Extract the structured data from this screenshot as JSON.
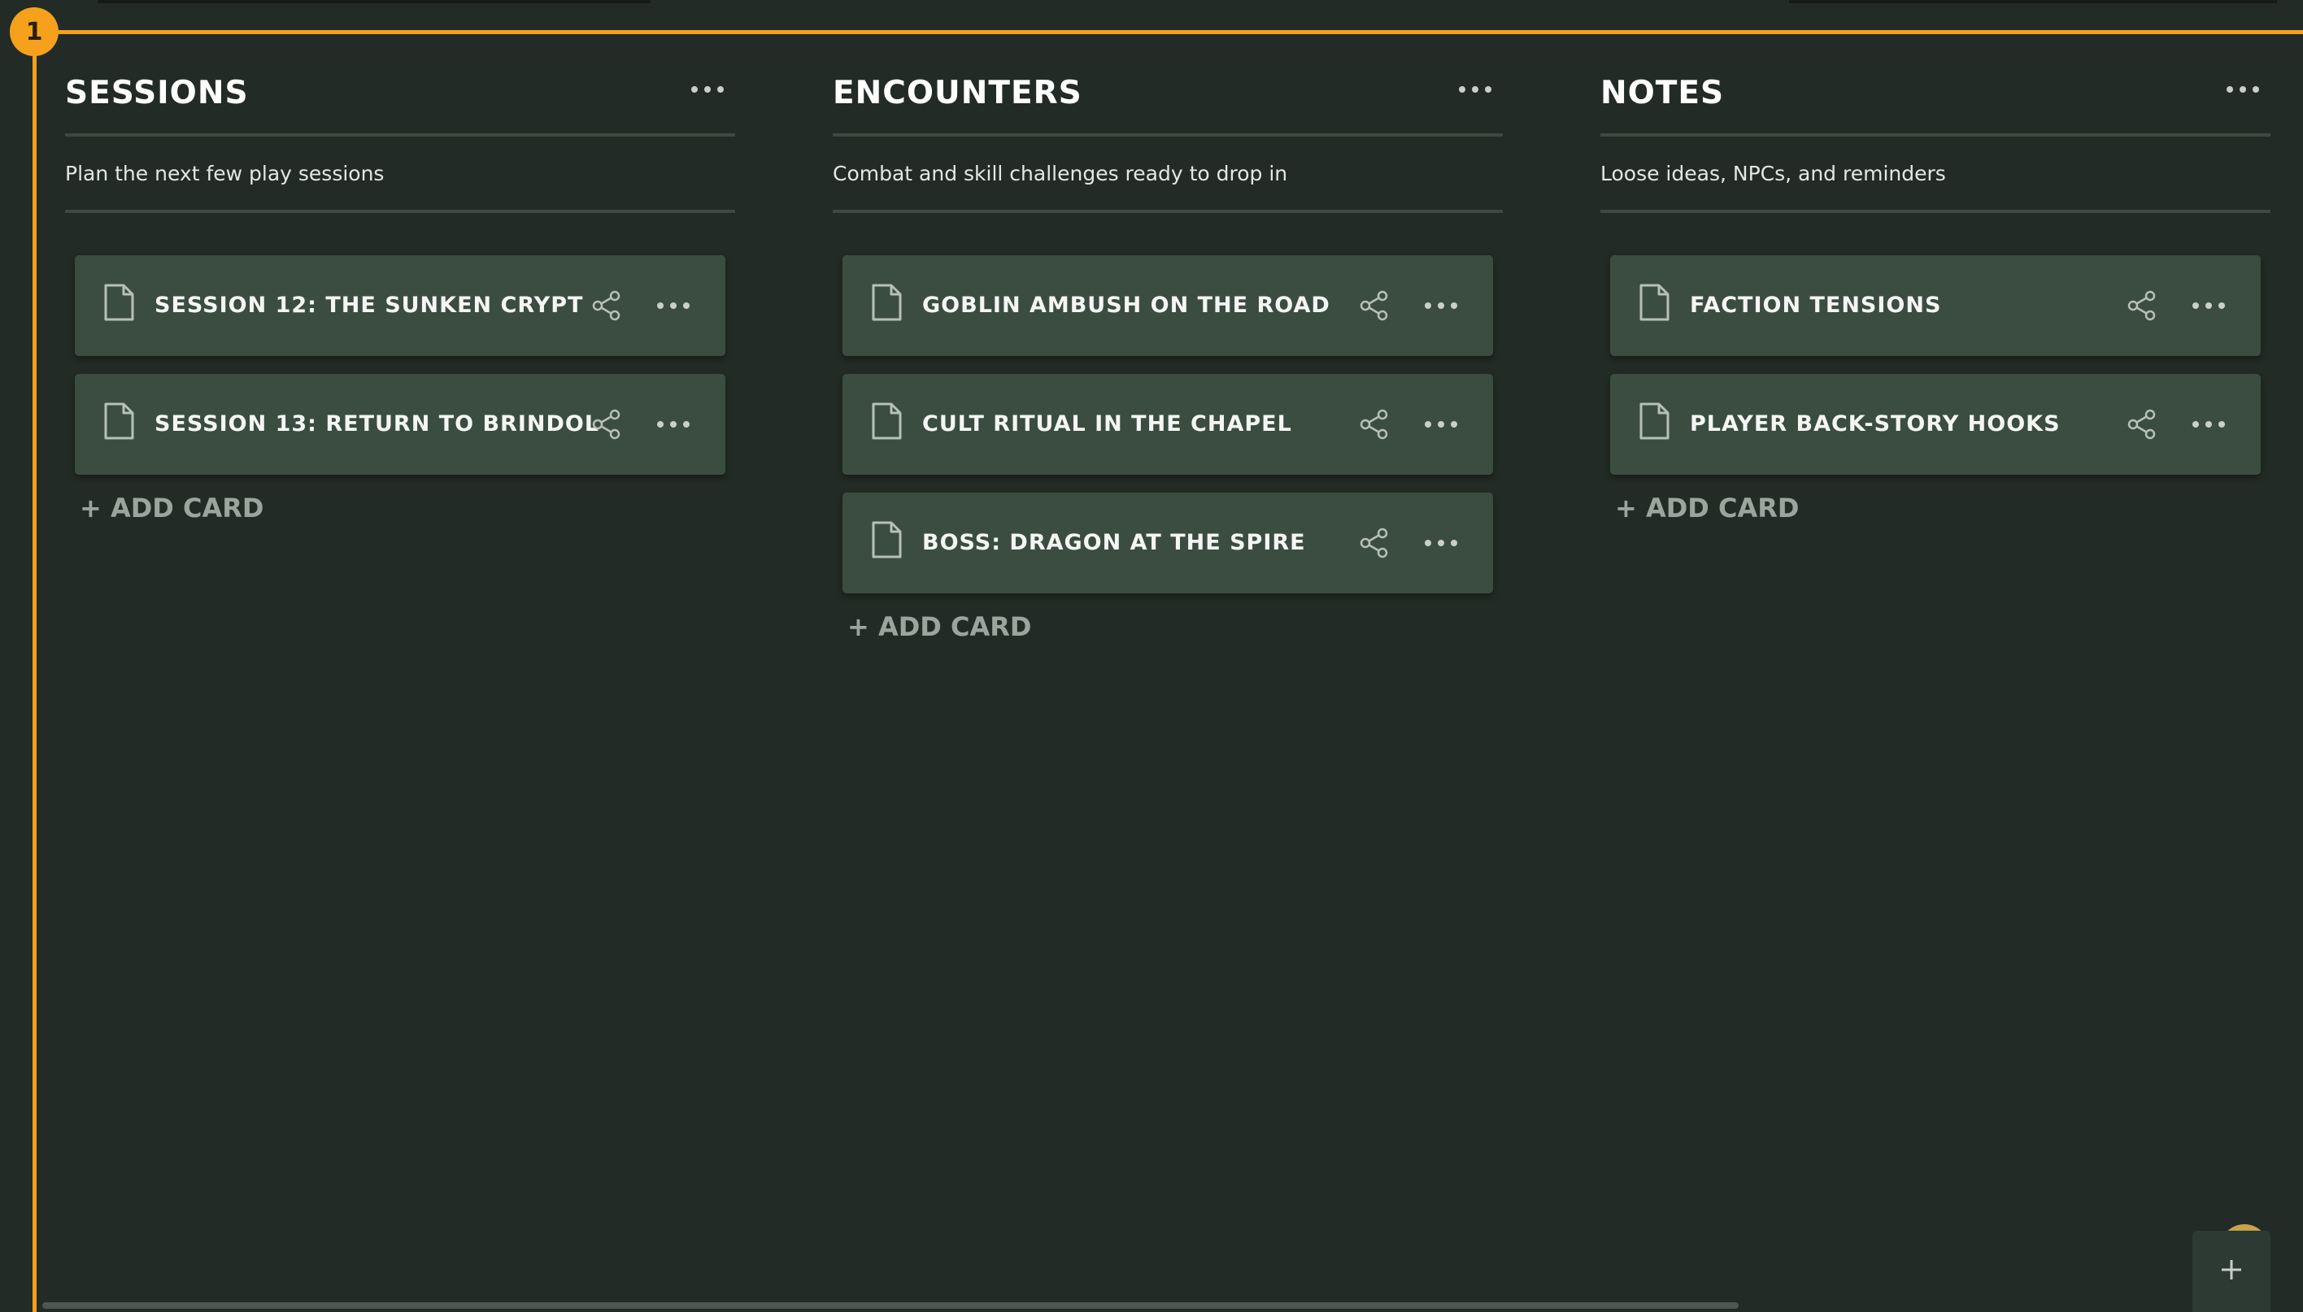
{
  "board": {
    "badge_number": "1"
  },
  "columns": [
    {
      "title": "SESSIONS",
      "description": "Plan the next few play sessions",
      "cards": [
        {
          "title": "SESSION 12: THE SUNKEN CRYPT"
        },
        {
          "title": "SESSION 13: RETURN TO BRINDOL"
        }
      ],
      "add_label": "+ ADD CARD"
    },
    {
      "title": "ENCOUNTERS",
      "description": "Combat and skill challenges ready to drop in",
      "cards": [
        {
          "title": "GOBLIN AMBUSH ON THE ROAD"
        },
        {
          "title": "CULT RITUAL IN THE CHAPEL"
        },
        {
          "title": "BOSS: DRAGON AT THE SPIRE"
        }
      ],
      "add_label": "+ ADD CARD"
    },
    {
      "title": "NOTES",
      "description": "Loose ideas, NPCs, and reminders",
      "cards": [
        {
          "title": "FACTION TENSIONS"
        },
        {
          "title": "PLAYER BACK-STORY HOOKS"
        }
      ],
      "add_label": "+ ADD CARD"
    }
  ],
  "fab": {
    "icon": "plus-icon"
  },
  "colors": {
    "background": "#222b25",
    "card": "#3b4d41",
    "accent": "#f5a11c",
    "muted_text": "#9aa59e"
  }
}
